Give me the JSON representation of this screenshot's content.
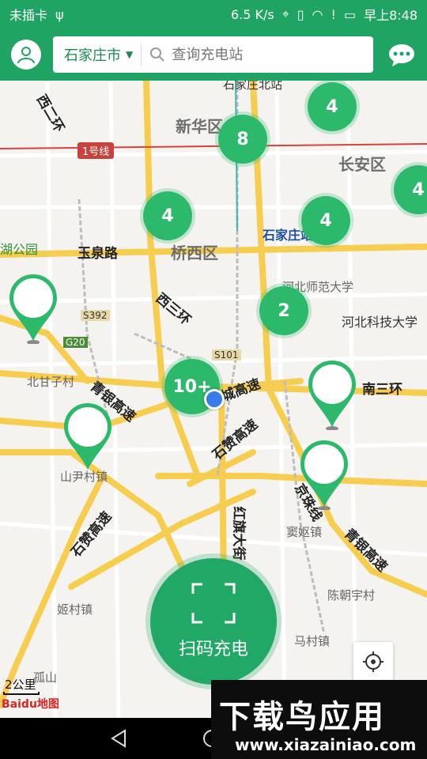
{
  "status_bar": {
    "carrier": "未插卡",
    "speed": "6.5 K/s",
    "time": "早上8:48",
    "icons": [
      "usb-icon",
      "location-icon",
      "vibrate-icon",
      "wifi-icon",
      "sim-alert-icon",
      "battery-icon"
    ]
  },
  "header": {
    "city": "石家庄市",
    "search_placeholder": "查询充电站",
    "icons": [
      "avatar-icon",
      "chevron-down-icon",
      "search-icon",
      "message-icon"
    ]
  },
  "map": {
    "labels": {
      "xinhua": "新华区",
      "changan": "长安区",
      "qiaoxi": "桥西区",
      "xisanhuan1": "西三环",
      "yuquanlu": "玉泉路",
      "xierhuan": "西二环",
      "line1": "1号线",
      "sjz_station": "石家庄站",
      "sjz_north": "石家庄北站",
      "hebei_normal": "河北师范大学",
      "hebei_tech": "河北科技大学",
      "nansanhuan": "南三环",
      "beiganzicun": "北甘子村",
      "qingyin1": "青银高速",
      "qingyin2": "青银高速",
      "shizan1": "石赞高速",
      "shizan2": "石赞高速",
      "shanyincun": "山尹村镇",
      "hongqi": "红旗大街",
      "douyu": "窦妪镇",
      "chenzhaoyu": "陈朝宇村",
      "jicun": "姬村镇",
      "macun": "马村镇",
      "gushan": "孤山",
      "hupark": "湖公园",
      "g20": "G20",
      "s392": "S392",
      "s101": "S101",
      "jingzhu": "京珠线",
      "huanrao": "绕城高速"
    },
    "clusters": [
      "4",
      "8",
      "4",
      "4",
      "4",
      "2",
      "10+"
    ],
    "scale_text": "2公里",
    "attribution": "Baidu地图"
  },
  "scan_button": {
    "label": "扫码充电"
  },
  "watermark": {
    "title": "下载鸟应用",
    "url": "www.xiazainiao.com"
  },
  "colors": {
    "brand_green": "#1fa463",
    "cluster_green": "#2cb96b",
    "road_yellow": "#f7cd4f",
    "metro_red": "#d9413b"
  }
}
